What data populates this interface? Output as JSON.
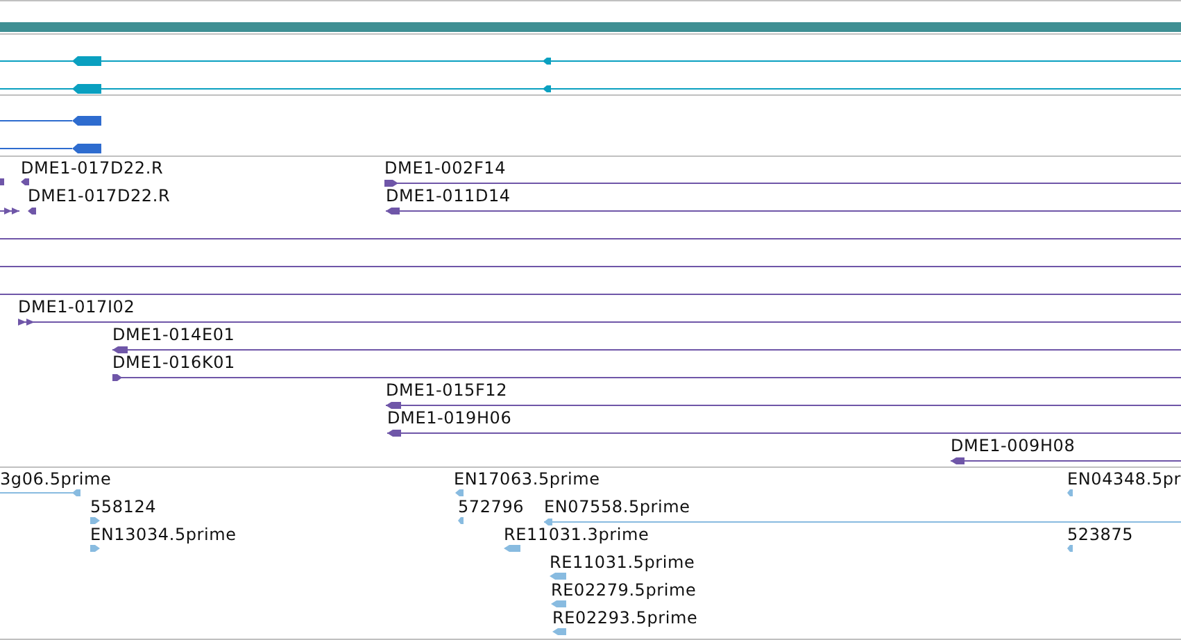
{
  "tracks": [
    {
      "color": "#0aa0c0",
      "features": [
        {
          "kind": "bare",
          "reverse": true
        },
        {
          "kind": "bare",
          "reverse": true
        }
      ]
    },
    {
      "color": "#2e6ccf",
      "features": [
        {
          "kind": "bare",
          "reverse": true
        },
        {
          "kind": "bare",
          "reverse": true
        }
      ]
    },
    {
      "color": "#6f56a8",
      "features": [
        {
          "kind": "labeled",
          "label": "DME1-017D22.R",
          "reverse": true
        },
        {
          "kind": "labeled",
          "label": "DME1-002F14",
          "reverse": false
        },
        {
          "kind": "bare",
          "reverse": false
        },
        {
          "kind": "labeled",
          "label": "DME1-017D22.R",
          "reverse": true
        },
        {
          "kind": "labeled",
          "label": "DME1-011D14",
          "reverse": true
        },
        {
          "kind": "line"
        },
        {
          "kind": "line"
        },
        {
          "kind": "line"
        },
        {
          "kind": "labeled",
          "label": "DME1-017I02",
          "reverse": false
        },
        {
          "kind": "labeled",
          "label": "DME1-014E01",
          "reverse": true
        },
        {
          "kind": "labeled",
          "label": "DME1-016K01",
          "reverse": false
        },
        {
          "kind": "labeled",
          "label": "DME1-015F12",
          "reverse": true
        },
        {
          "kind": "labeled",
          "label": "DME1-019H06",
          "reverse": true
        },
        {
          "kind": "labeled",
          "label": "DME1-009H08",
          "reverse": true
        }
      ]
    },
    {
      "color": "#88bbe0",
      "features": [
        {
          "kind": "labeled",
          "label": "3g06.5prime",
          "reverse": true
        },
        {
          "kind": "labeled",
          "label": "558124",
          "reverse": false
        },
        {
          "kind": "labeled",
          "label": "EN13034.5prime",
          "reverse": false
        },
        {
          "kind": "labeled",
          "label": "EN17063.5prime",
          "reverse": true
        },
        {
          "kind": "labeled",
          "label": "572796",
          "reverse": true
        },
        {
          "kind": "labeled",
          "label": "EN07558.5prime",
          "reverse": true
        },
        {
          "kind": "labeled",
          "label": "RE11031.3prime",
          "reverse": true
        },
        {
          "kind": "labeled",
          "label": "RE11031.5prime",
          "reverse": true
        },
        {
          "kind": "labeled",
          "label": "RE02279.5prime",
          "reverse": true
        },
        {
          "kind": "labeled",
          "label": "RE02293.5prime",
          "reverse": true
        },
        {
          "kind": "labeled",
          "label": "EN04348.5pr",
          "reverse": true
        },
        {
          "kind": "labeled",
          "label": "523875",
          "reverse": true
        }
      ]
    }
  ]
}
